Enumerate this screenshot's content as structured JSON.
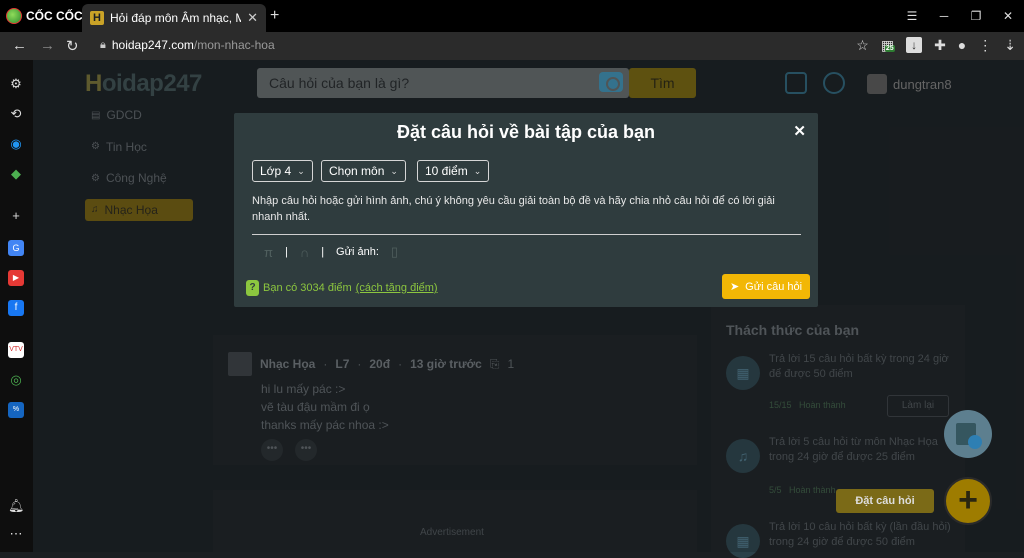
{
  "browser": {
    "brand": "CỐC CỐC",
    "tab_title": "Hỏi đáp môn Âm nhạc, Mỹ thuật",
    "tab_close": "✕",
    "new_tab": "+",
    "url_host": "hoidap247.com",
    "url_path": "/mon-nhac-hoa",
    "calendar_badge": "25"
  },
  "header": {
    "logo": "Hoidap247",
    "search_placeholder": "Câu hỏi của bạn là gì?",
    "search_button": "Tìm",
    "username": "dungtran8"
  },
  "left_nav": [
    {
      "label": "GDCD",
      "icon": "▤"
    },
    {
      "label": "Tin Học",
      "icon": "⚙"
    },
    {
      "label": "Công Nghệ",
      "icon": "⚙"
    },
    {
      "label": "Nhạc Họa",
      "icon": "♫"
    }
  ],
  "post": {
    "meta_subject": "Nhạc Họa",
    "meta_grade": "L7",
    "meta_points": "20đ",
    "meta_time": "13 giờ trước",
    "meta_attach": "1",
    "lines": [
      "hi lu mấy pác :>",
      "vẽ tàu đậu mầm đi ọ",
      "thanks mấy pác nhoa :>"
    ],
    "ad_label": "Advertisement"
  },
  "challenges": {
    "title": "Thách thức của bạn",
    "items": [
      {
        "text": "Trả lời 15 câu hỏi  bất kỳ  trong 24 giờ để được 50 điểm",
        "progress": "15/15",
        "status": "Hoàn thành",
        "button": "Làm lại"
      },
      {
        "text": "Trả lời 5 câu hỏi  từ môn Nhạc Họa trong 24 giờ để được 25 điểm",
        "progress": "5/5",
        "status": "Hoàn thành",
        "button": ""
      },
      {
        "text": "Trả lời 10 câu hỏi  bất kỳ (lần đầu hỏi) trong 24 giờ để được 50 điểm",
        "progress": "",
        "status": "",
        "button": ""
      }
    ]
  },
  "modal": {
    "title": "Đặt câu hỏi về bài tập của bạn",
    "close": "✕",
    "grade_select": "Lớp 4",
    "subject_select": "Chọn môn",
    "points_select": "10 điểm",
    "prompt": "Nhập câu hỏi hoặc gửi hình ảnh, chú ý không yêu cầu giải toàn bộ đề và hãy chia nhỏ câu hỏi để có lời giải nhanh nhất.",
    "math_symbol": "π",
    "separator": "|",
    "send_image_label": "Gửi ảnh:",
    "points_text": "Bạn có 3034 điểm",
    "points_link": "(cách tăng điểm)",
    "submit": "Gửi câu hỏi"
  },
  "fab": {
    "ask_label": "Đặt câu hỏi",
    "add_symbol": "+"
  }
}
